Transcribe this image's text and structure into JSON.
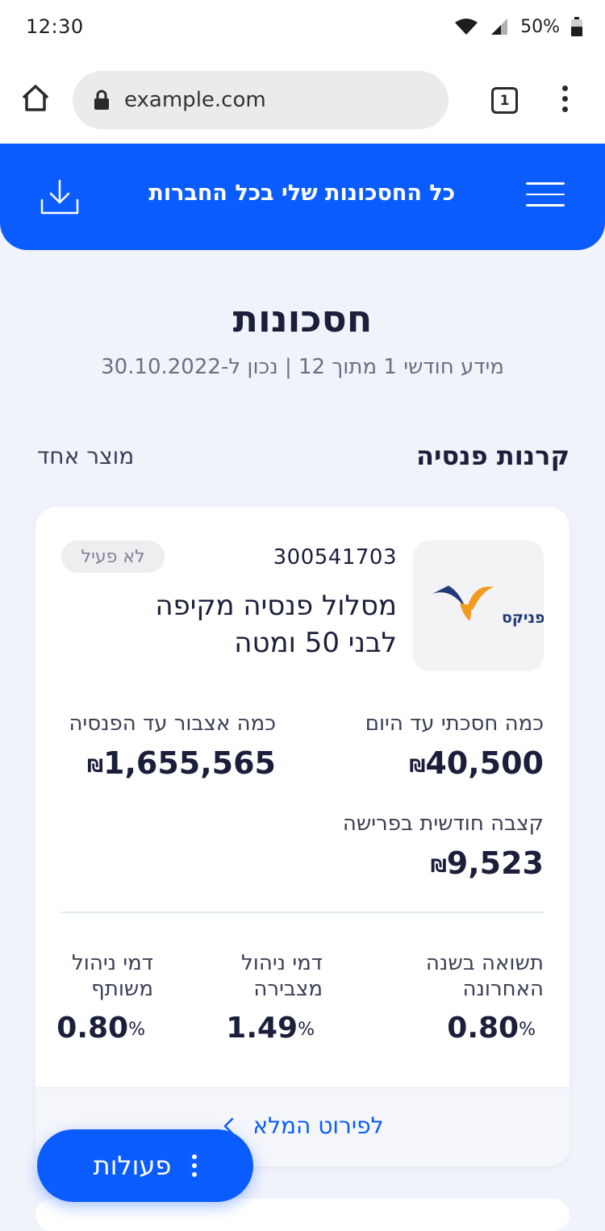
{
  "status_bar": {
    "time": "12:30",
    "battery": "50%",
    "icons": [
      "wifi-icon",
      "signal-icon",
      "battery-icon"
    ]
  },
  "browser": {
    "url": "example.com",
    "tab_count": "1"
  },
  "header": {
    "title": "כל החסכונות שלי בכל החברות",
    "accent_color": "#0b5cff"
  },
  "page": {
    "title": "חסכונות",
    "subtitle": "מידע חודשי 1 מתוך 12 | נכון ל-30.10.2022"
  },
  "section": {
    "title": "קרנות פנסיה",
    "count": "מוצר אחד"
  },
  "card": {
    "logo_text": "הפניקס",
    "policy_number": "300541703",
    "status": "לא פעיל",
    "plan_name": "מסלול פנסיה מקיפה לבני 50 ומטה",
    "saved_label": "כמה חסכתי עד היום",
    "saved_value": "40,500",
    "accumulate_label": "כמה אצבור עד הפנסיה",
    "accumulate_value": "1,655,565",
    "pension_label": "קצבה חודשית בפרישה",
    "pension_value": "9,523",
    "currency": "₪",
    "return_label": "תשואה בשנה האחרונה",
    "return_value": "0.80",
    "fee_accum_label": "דמי ניהול מצבירה",
    "fee_accum_value": "1.49",
    "fee_joint_label": "דמי ניהול משותף",
    "fee_joint_value": "0.80",
    "percent": "%",
    "details_link": "לפירוט המלא"
  },
  "actions": {
    "label": "פעולות"
  }
}
